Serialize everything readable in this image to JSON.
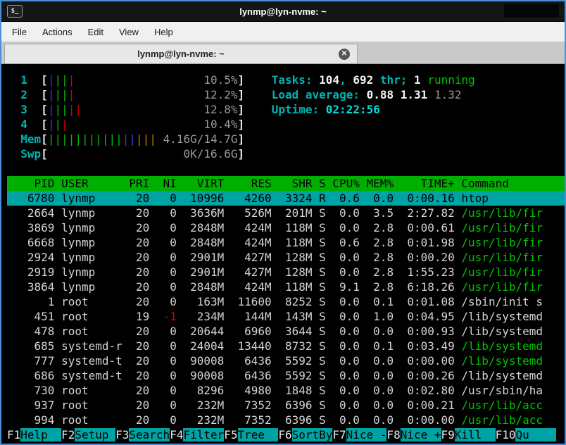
{
  "window": {
    "title": "lynmp@lyn-nvme: ~",
    "icon_glyph": "$_"
  },
  "menu": {
    "items": [
      "File",
      "Actions",
      "Edit",
      "View",
      "Help"
    ]
  },
  "tab": {
    "title": "lynmp@lyn-nvme: ~",
    "close_glyph": "✕"
  },
  "colors": {
    "border_accent": "#4a90d9",
    "header_bg": "#00b000",
    "selection_bg": "#00a3a3",
    "fkey_bg": "#00a3a3",
    "cyan": "#00b3b3",
    "green": "#00c400",
    "red": "#d40000",
    "blue": "#3b3be0",
    "orange": "#c07f00"
  },
  "htop": {
    "meters": [
      {
        "label": "1",
        "pct": "10.5%",
        "pipes": [
          [
            "blue",
            1
          ],
          [
            "green",
            2
          ],
          [
            "red",
            1
          ]
        ]
      },
      {
        "label": "2",
        "pct": "12.2%",
        "pipes": [
          [
            "blue",
            1
          ],
          [
            "green",
            2
          ],
          [
            "red",
            1
          ]
        ]
      },
      {
        "label": "3",
        "pct": "12.8%",
        "pipes": [
          [
            "blue",
            1
          ],
          [
            "green",
            2
          ],
          [
            "red",
            2
          ]
        ]
      },
      {
        "label": "4",
        "pct": "10.4%",
        "pipes": [
          [
            "blue",
            1
          ],
          [
            "green",
            1
          ],
          [
            "red",
            1
          ]
        ]
      },
      {
        "label": "Mem",
        "pct": "4.16G/14.7G",
        "pipes": [
          [
            "green",
            11
          ],
          [
            "blue",
            2
          ],
          [
            "orange",
            3
          ]
        ]
      },
      {
        "label": "Swp",
        "pct": "0K/16.6G",
        "pipes": []
      }
    ],
    "info": [
      [
        {
          "c": "label",
          "t": "Tasks: "
        },
        {
          "c": "bold",
          "t": "104"
        },
        {
          "c": "label",
          "t": ", "
        },
        {
          "c": "bold",
          "t": "692"
        },
        {
          "c": "label",
          "t": " thr; "
        },
        {
          "c": "bold",
          "t": "1"
        },
        {
          "c": "green",
          "t": " running"
        }
      ],
      [
        {
          "c": "label",
          "t": "Load average: "
        },
        {
          "c": "bold",
          "t": "0.88 "
        },
        {
          "c": "bold",
          "t": "1.31 "
        },
        {
          "c": "dim",
          "t": "1.32"
        }
      ],
      [
        {
          "c": "label",
          "t": "Uptime: "
        },
        {
          "c": "time",
          "t": "02:22:56"
        }
      ]
    ],
    "columns": [
      "PID",
      "USER",
      "PRI",
      "NI",
      "VIRT",
      "RES",
      "SHR",
      "S",
      "CPU%",
      "MEM%",
      "TIME+",
      "Command"
    ],
    "rows": [
      {
        "pid": "6780",
        "user": "lynmp",
        "pri": "20",
        "ni": "0",
        "virt": "10996",
        "res": "4260",
        "shr": "3324",
        "s": "R",
        "cpu": "0.6",
        "mem": "0.0",
        "time": "0:00.16",
        "cmd": "htop",
        "selected": true,
        "cmd_green": false,
        "ni_red": false
      },
      {
        "pid": "2664",
        "user": "lynmp",
        "pri": "20",
        "ni": "0",
        "virt": "3636M",
        "res": "526M",
        "shr": "201M",
        "s": "S",
        "cpu": "0.0",
        "mem": "3.5",
        "time": "2:27.82",
        "cmd": "/usr/lib/fir",
        "selected": false,
        "cmd_green": true,
        "ni_red": false
      },
      {
        "pid": "3869",
        "user": "lynmp",
        "pri": "20",
        "ni": "0",
        "virt": "2848M",
        "res": "424M",
        "shr": "118M",
        "s": "S",
        "cpu": "0.0",
        "mem": "2.8",
        "time": "0:00.61",
        "cmd": "/usr/lib/fir",
        "selected": false,
        "cmd_green": true,
        "ni_red": false
      },
      {
        "pid": "6668",
        "user": "lynmp",
        "pri": "20",
        "ni": "0",
        "virt": "2848M",
        "res": "424M",
        "shr": "118M",
        "s": "S",
        "cpu": "0.6",
        "mem": "2.8",
        "time": "0:01.98",
        "cmd": "/usr/lib/fir",
        "selected": false,
        "cmd_green": true,
        "ni_red": false
      },
      {
        "pid": "2924",
        "user": "lynmp",
        "pri": "20",
        "ni": "0",
        "virt": "2901M",
        "res": "427M",
        "shr": "128M",
        "s": "S",
        "cpu": "0.0",
        "mem": "2.8",
        "time": "0:00.20",
        "cmd": "/usr/lib/fir",
        "selected": false,
        "cmd_green": true,
        "ni_red": false
      },
      {
        "pid": "2919",
        "user": "lynmp",
        "pri": "20",
        "ni": "0",
        "virt": "2901M",
        "res": "427M",
        "shr": "128M",
        "s": "S",
        "cpu": "0.0",
        "mem": "2.8",
        "time": "1:55.23",
        "cmd": "/usr/lib/fir",
        "selected": false,
        "cmd_green": true,
        "ni_red": false
      },
      {
        "pid": "3864",
        "user": "lynmp",
        "pri": "20",
        "ni": "0",
        "virt": "2848M",
        "res": "424M",
        "shr": "118M",
        "s": "S",
        "cpu": "9.1",
        "mem": "2.8",
        "time": "6:18.26",
        "cmd": "/usr/lib/fir",
        "selected": false,
        "cmd_green": true,
        "ni_red": false
      },
      {
        "pid": "1",
        "user": "root",
        "pri": "20",
        "ni": "0",
        "virt": "163M",
        "res": "11600",
        "shr": "8252",
        "s": "S",
        "cpu": "0.0",
        "mem": "0.1",
        "time": "0:01.08",
        "cmd": "/sbin/init s",
        "selected": false,
        "cmd_green": false,
        "ni_red": false
      },
      {
        "pid": "451",
        "user": "root",
        "pri": "19",
        "ni": "-1",
        "virt": "234M",
        "res": "144M",
        "shr": "143M",
        "s": "S",
        "cpu": "0.0",
        "mem": "1.0",
        "time": "0:04.95",
        "cmd": "/lib/systemd",
        "selected": false,
        "cmd_green": false,
        "ni_red": true
      },
      {
        "pid": "478",
        "user": "root",
        "pri": "20",
        "ni": "0",
        "virt": "20644",
        "res": "6960",
        "shr": "3644",
        "s": "S",
        "cpu": "0.0",
        "mem": "0.0",
        "time": "0:00.93",
        "cmd": "/lib/systemd",
        "selected": false,
        "cmd_green": false,
        "ni_red": false
      },
      {
        "pid": "685",
        "user": "systemd-r",
        "pri": "20",
        "ni": "0",
        "virt": "24004",
        "res": "13440",
        "shr": "8732",
        "s": "S",
        "cpu": "0.0",
        "mem": "0.1",
        "time": "0:03.49",
        "cmd": "/lib/systemd",
        "selected": false,
        "cmd_green": true,
        "ni_red": false
      },
      {
        "pid": "777",
        "user": "systemd-t",
        "pri": "20",
        "ni": "0",
        "virt": "90008",
        "res": "6436",
        "shr": "5592",
        "s": "S",
        "cpu": "0.0",
        "mem": "0.0",
        "time": "0:00.00",
        "cmd": "/lib/systemd",
        "selected": false,
        "cmd_green": true,
        "ni_red": false
      },
      {
        "pid": "686",
        "user": "systemd-t",
        "pri": "20",
        "ni": "0",
        "virt": "90008",
        "res": "6436",
        "shr": "5592",
        "s": "S",
        "cpu": "0.0",
        "mem": "0.0",
        "time": "0:00.26",
        "cmd": "/lib/systemd",
        "selected": false,
        "cmd_green": false,
        "ni_red": false
      },
      {
        "pid": "730",
        "user": "root",
        "pri": "20",
        "ni": "0",
        "virt": "8296",
        "res": "4980",
        "shr": "1848",
        "s": "S",
        "cpu": "0.0",
        "mem": "0.0",
        "time": "0:02.80",
        "cmd": "/usr/sbin/ha",
        "selected": false,
        "cmd_green": false,
        "ni_red": false
      },
      {
        "pid": "937",
        "user": "root",
        "pri": "20",
        "ni": "0",
        "virt": "232M",
        "res": "7352",
        "shr": "6396",
        "s": "S",
        "cpu": "0.0",
        "mem": "0.0",
        "time": "0:00.21",
        "cmd": "/usr/lib/acc",
        "selected": false,
        "cmd_green": true,
        "ni_red": false
      },
      {
        "pid": "994",
        "user": "root",
        "pri": "20",
        "ni": "0",
        "virt": "232M",
        "res": "7352",
        "shr": "6396",
        "s": "S",
        "cpu": "0.0",
        "mem": "0.0",
        "time": "0:00.00",
        "cmd": "/usr/lib/acc",
        "selected": false,
        "cmd_green": true,
        "ni_red": false
      }
    ],
    "fkeys": [
      {
        "key": "F1",
        "label": "Help"
      },
      {
        "key": "F2",
        "label": "Setup"
      },
      {
        "key": "F3",
        "label": "Search"
      },
      {
        "key": "F4",
        "label": "Filter"
      },
      {
        "key": "F5",
        "label": "Tree"
      },
      {
        "key": "F6",
        "label": "SortBy"
      },
      {
        "key": "F7",
        "label": "Nice -"
      },
      {
        "key": "F8",
        "label": "Nice +"
      },
      {
        "key": "F9",
        "label": "Kill"
      },
      {
        "key": "F10",
        "label": "Qu"
      }
    ]
  }
}
